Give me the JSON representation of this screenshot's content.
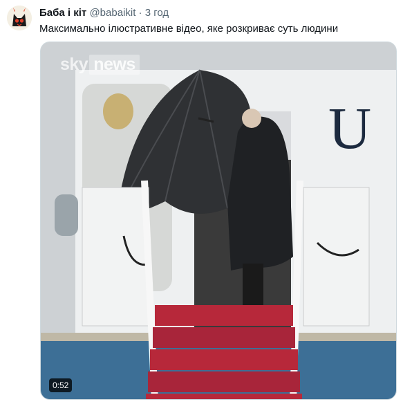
{
  "author": {
    "display_name": "Баба і кіт",
    "handle": "@babaikit",
    "separator": "·",
    "time": "3 год"
  },
  "tweet_text": "Максимально ілюстративне відео, яке розкриває суть людини",
  "video": {
    "watermark_sky": "sky",
    "watermark_news": "news",
    "plane_lettering": "U",
    "duration": "0:52"
  }
}
